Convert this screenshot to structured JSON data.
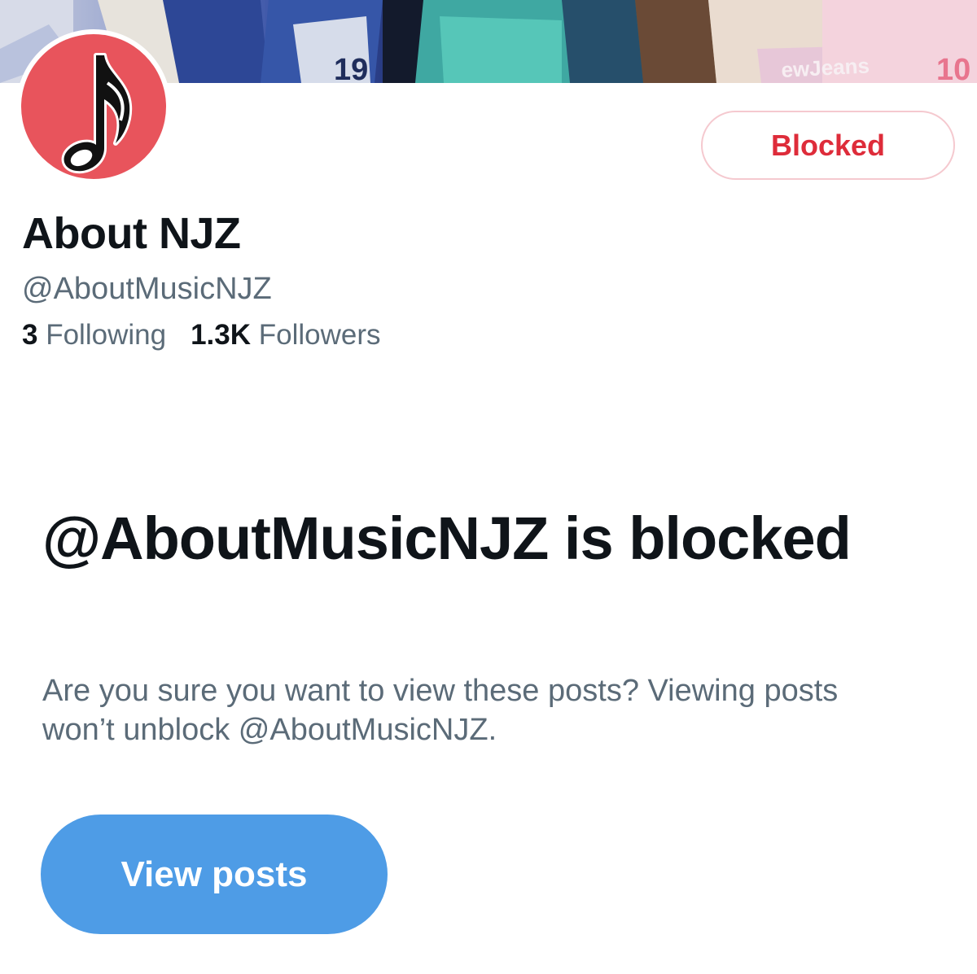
{
  "profile": {
    "display_name": "About NJZ",
    "handle": "@AboutMusicNJZ",
    "following_count": "3",
    "following_label": "Following",
    "followers_count": "1.3K",
    "followers_label": "Followers",
    "avatar_color": "#e8545c",
    "avatar_icon": "music-note-icon"
  },
  "actions": {
    "blocked_label": "Blocked",
    "blocked_color": "#de2c3a",
    "view_posts_label": "View posts",
    "view_posts_color": "#4e9ce6"
  },
  "notice": {
    "title": "@AboutMusicNJZ is blocked",
    "body": "Are you sure you want to view these posts? Viewing posts won’t unblock @AboutMusicNJZ."
  }
}
